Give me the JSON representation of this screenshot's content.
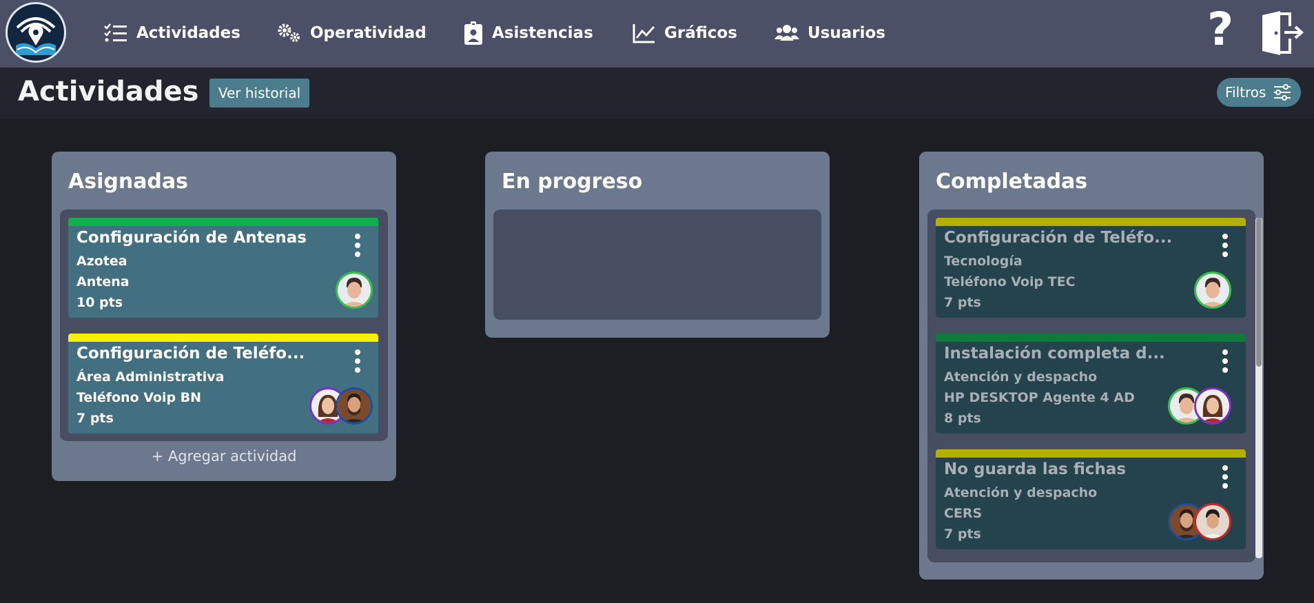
{
  "nav": {
    "items": [
      {
        "label": "Actividades",
        "icon": "checklist-icon"
      },
      {
        "label": "Operatividad",
        "icon": "gears-icon"
      },
      {
        "label": "Asistencias",
        "icon": "id-badge-icon"
      },
      {
        "label": "Gráficos",
        "icon": "line-chart-icon"
      },
      {
        "label": "Usuarios",
        "icon": "users-icon"
      }
    ],
    "help_label": "?"
  },
  "header": {
    "title": "Actividades",
    "history_label": "Ver historial",
    "filters_label": "Filtros"
  },
  "columns": [
    {
      "title": "Asignadas",
      "add_label": "+ Agregar actividad",
      "cards": [
        {
          "title": "Configuración de Antenas",
          "area": "Azotea",
          "device": "Antena",
          "points": "10 pts",
          "color": "#0fb04f"
        },
        {
          "title": "Configuración de Teléfo...",
          "area": "Área Administrativa",
          "device": "Teléfono Voip BN",
          "points": "7 pts",
          "color": "#f8f000"
        }
      ]
    },
    {
      "title": "En progreso",
      "cards": []
    },
    {
      "title": "Completadas",
      "cards": [
        {
          "title": "Configuración de Teléfo...",
          "area": "Tecnología",
          "device": "Teléfono Voip TEC",
          "points": "7 pts",
          "color": "#b3b000"
        },
        {
          "title": "Instalación completa d...",
          "area": "Atención y despacho",
          "device": "HP DESKTOP Agente 4 AD",
          "points": "8 pts",
          "color": "#0c7a3d"
        },
        {
          "title": "No guarda las fichas",
          "area": "Atención y despacho",
          "device": "CERS",
          "points": "7 pts",
          "color": "#b3b000"
        }
      ]
    }
  ],
  "colors": {
    "navbar": "#4b5066",
    "accent_teal": "#4c7d8d",
    "column_bg": "#6c788e",
    "card_active": "#427080",
    "card_done": "#24434c"
  }
}
